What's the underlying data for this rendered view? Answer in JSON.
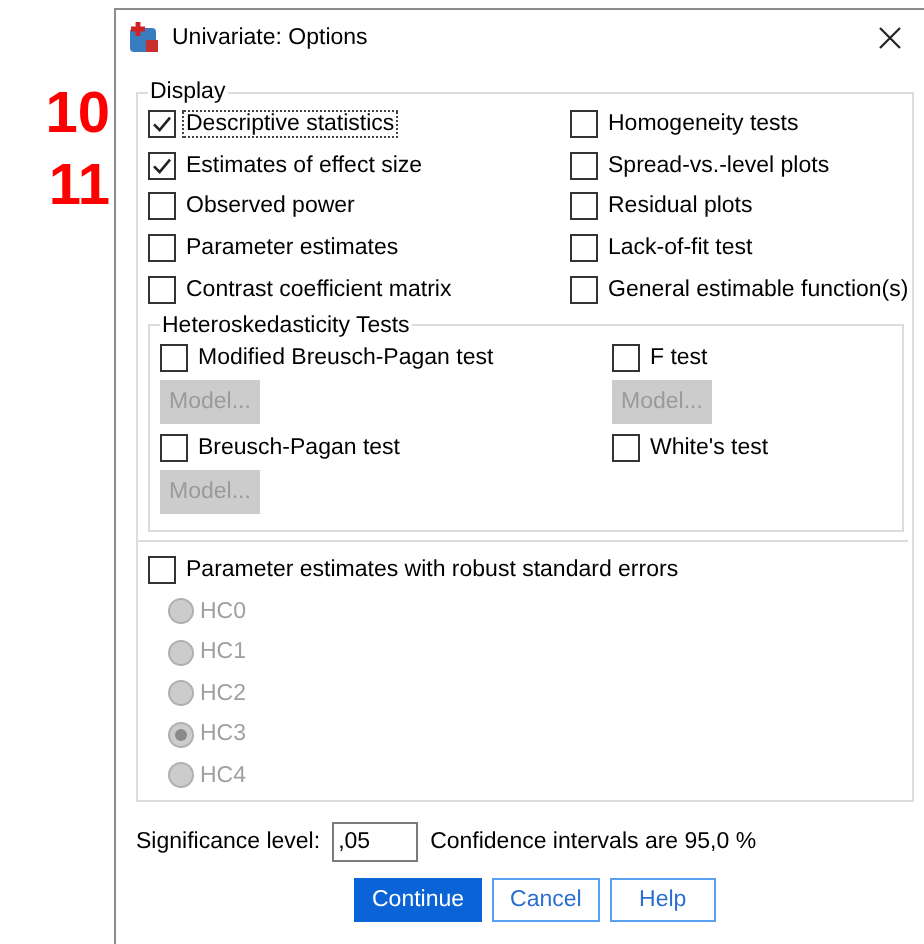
{
  "annotations": [
    {
      "label": "10"
    },
    {
      "label": "11"
    }
  ],
  "window": {
    "title": "Univariate: Options"
  },
  "display": {
    "label": "Display",
    "left": [
      {
        "label": "Descriptive statistics",
        "checked": true,
        "focused": true
      },
      {
        "label": "Estimates of effect size",
        "checked": true,
        "focused": false
      },
      {
        "label": "Observed power",
        "checked": false,
        "focused": false
      },
      {
        "label": "Parameter estimates",
        "checked": false,
        "focused": false
      },
      {
        "label": "Contrast coefficient matrix",
        "checked": false,
        "focused": false
      }
    ],
    "right": [
      {
        "label": "Homogeneity tests",
        "checked": false,
        "focused": false
      },
      {
        "label": "Spread-vs.-level plots",
        "checked": false,
        "focused": false
      },
      {
        "label": "Residual plots",
        "checked": false,
        "focused": false
      },
      {
        "label": "Lack-of-fit test",
        "checked": false,
        "focused": false
      },
      {
        "label": "General estimable function(s)",
        "checked": false,
        "focused": false
      }
    ]
  },
  "heteroskedasticity": {
    "label": "Heteroskedasticity Tests",
    "tests": [
      {
        "label": "Modified Breusch-Pagan test",
        "checked": false,
        "model_button": {
          "label": "Model...",
          "disabled": true
        }
      },
      {
        "label": "F test",
        "checked": false,
        "model_button": {
          "label": "Model...",
          "disabled": true
        }
      },
      {
        "label": "Breusch-Pagan test",
        "checked": false,
        "model_button": {
          "label": "Model...",
          "disabled": true
        }
      },
      {
        "label": "White's test",
        "checked": false
      }
    ]
  },
  "robust": {
    "label": "Parameter estimates with robust standard errors",
    "checked": false,
    "options": [
      {
        "label": "HC0",
        "selected": false,
        "disabled": true
      },
      {
        "label": "HC1",
        "selected": false,
        "disabled": true
      },
      {
        "label": "HC2",
        "selected": false,
        "disabled": true
      },
      {
        "label": "HC3",
        "selected": true,
        "disabled": true
      },
      {
        "label": "HC4",
        "selected": false,
        "disabled": true
      }
    ]
  },
  "significance": {
    "label": "Significance level:",
    "value": ",05",
    "confidence": "Confidence intervals are 95,0 %"
  },
  "buttons": [
    {
      "label": "Continue",
      "kind": "default"
    },
    {
      "label": "Cancel",
      "kind": "normal"
    },
    {
      "label": "Help",
      "kind": "normal"
    }
  ]
}
